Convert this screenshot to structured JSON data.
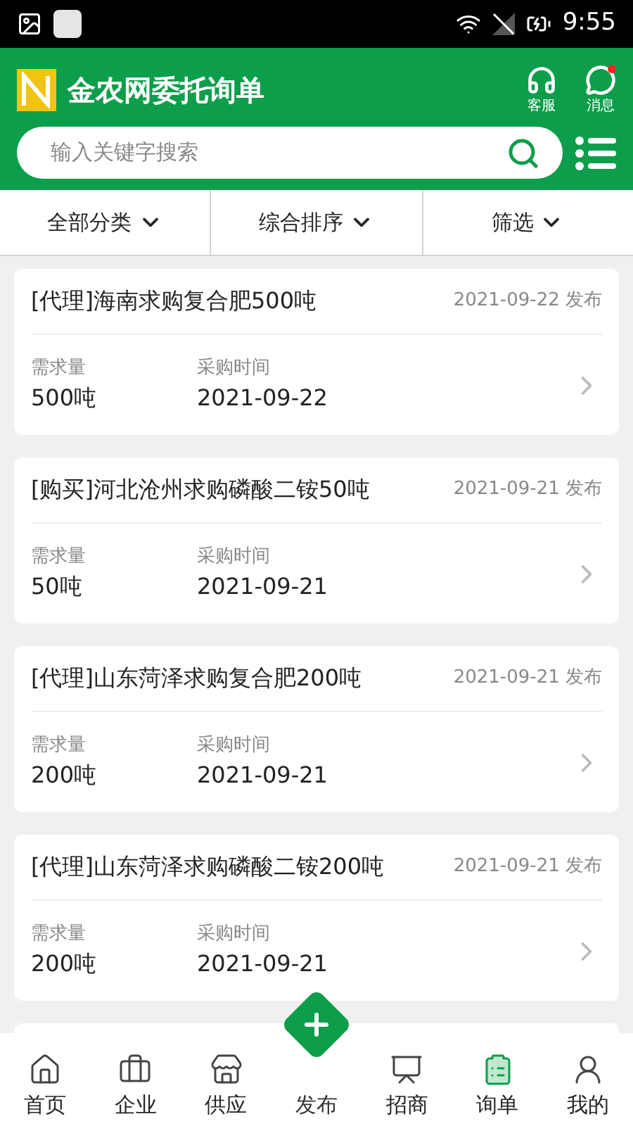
{
  "status_bar": {
    "time": "9:55"
  },
  "header": {
    "title": "金农网委托询单",
    "actions": [
      {
        "kind": "service",
        "label": "客服",
        "badge": false
      },
      {
        "kind": "message",
        "label": "消息",
        "badge": true
      }
    ]
  },
  "search": {
    "placeholder": "输入关键字搜索"
  },
  "filters": [
    {
      "label": "全部分类"
    },
    {
      "label": "综合排序"
    },
    {
      "label": "筛选"
    }
  ],
  "orders": [
    {
      "title": "[代理]海南求购复合肥500吨",
      "date": "2021-09-22 发布",
      "qty_label": "需求量",
      "qty": "500吨",
      "time_label": "采购时间",
      "time": "2021-09-22"
    },
    {
      "title": "[购买]河北沧州求购磷酸二铵50吨",
      "date": "2021-09-21 发布",
      "qty_label": "需求量",
      "qty": "50吨",
      "time_label": "采购时间",
      "time": "2021-09-21"
    },
    {
      "title": "[代理]山东菏泽求购复合肥200吨",
      "date": "2021-09-21 发布",
      "qty_label": "需求量",
      "qty": "200吨",
      "time_label": "采购时间",
      "time": "2021-09-21"
    },
    {
      "title": "[代理]山东菏泽求购磷酸二铵200吨",
      "date": "2021-09-21 发布",
      "qty_label": "需求量",
      "qty": "200吨",
      "time_label": "采购时间",
      "time": "2021-09-21"
    }
  ],
  "tabs": [
    {
      "kind": "home",
      "label": "首页",
      "selected": false
    },
    {
      "kind": "company",
      "label": "企业",
      "selected": false
    },
    {
      "kind": "supply",
      "label": "供应",
      "selected": false
    },
    {
      "kind": "publish",
      "label": "发布",
      "selected": false
    },
    {
      "kind": "invest",
      "label": "招商",
      "selected": false
    },
    {
      "kind": "inquiry",
      "label": "询单",
      "selected": true
    },
    {
      "kind": "mine",
      "label": "我的",
      "selected": false
    }
  ]
}
